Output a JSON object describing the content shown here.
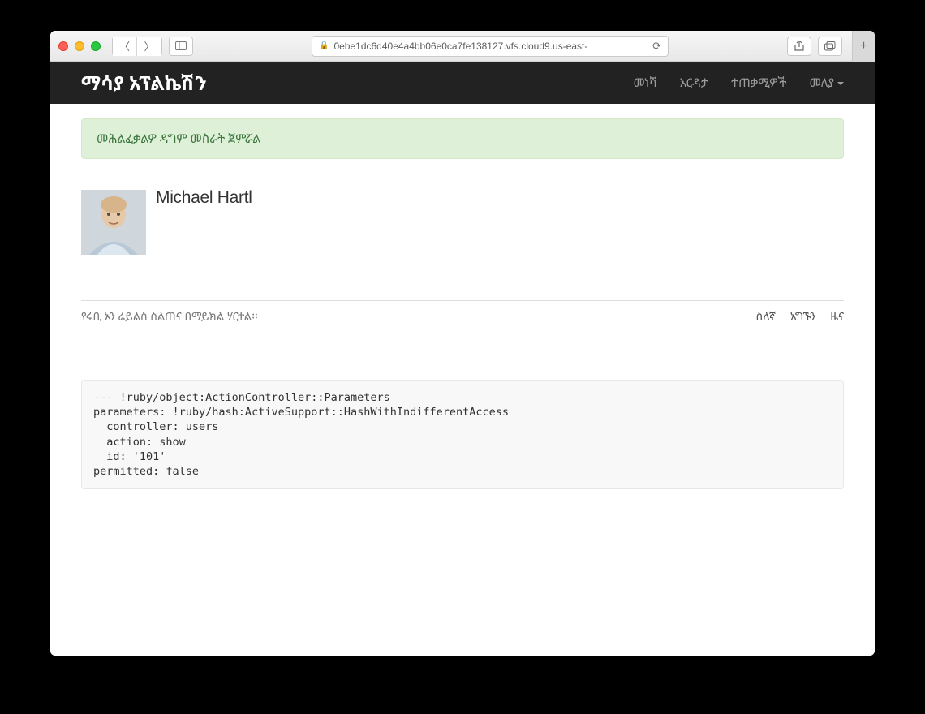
{
  "browser": {
    "url": "0ebe1dc6d40e4a4bb06e0ca7fe138127.vfs.cloud9.us-east-"
  },
  "nav": {
    "brand": "ማሳያ አፕልኬሽን",
    "links": {
      "home": "መነሻ",
      "help": "እርዳታ",
      "users": "ተጠቃሚዎች",
      "account": "መለያ"
    }
  },
  "alert": {
    "message": "መሕልፈቃልዎ ዳግም መስራት ጀምሯል"
  },
  "profile": {
    "name": "Michael Hartl"
  },
  "footer": {
    "tagline": "የሩቢ ኦን ሬይልስ ስልጠና በማይክል ሃርተል፡፡",
    "links": {
      "about": "ስለኛ",
      "contact": "አግኙን",
      "news": "ዜና"
    }
  },
  "debug": "--- !ruby/object:ActionController::Parameters\nparameters: !ruby/hash:ActiveSupport::HashWithIndifferentAccess\n  controller: users\n  action: show\n  id: '101'\npermitted: false"
}
